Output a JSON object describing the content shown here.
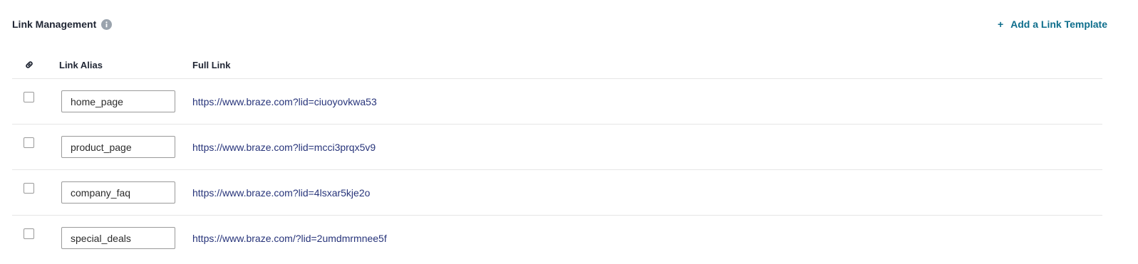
{
  "header": {
    "title": "Link Management",
    "add_template_label": "Add a Link Template",
    "add_template_icon": "plus-icon"
  },
  "table": {
    "columns": {
      "link_icon": "link-icon",
      "alias": "Link Alias",
      "full_link": "Full Link"
    },
    "rows": [
      {
        "alias": "home_page",
        "full_link": "https://www.braze.com?lid=ciuoyovkwa53",
        "checked": false
      },
      {
        "alias": "product_page",
        "full_link": "https://www.braze.com?lid=mcci3prqx5v9",
        "checked": false
      },
      {
        "alias": "company_faq",
        "full_link": "https://www.braze.com?lid=4lsxar5kje2o",
        "checked": false
      },
      {
        "alias": "special_deals",
        "full_link": "https://www.braze.com/?lid=2umdmrmnee5f",
        "checked": false
      }
    ]
  },
  "colors": {
    "accent": "#0e6e8c",
    "link": "#27347a",
    "info_icon": "#9aa3ad",
    "divider": "#e6e6e6"
  }
}
